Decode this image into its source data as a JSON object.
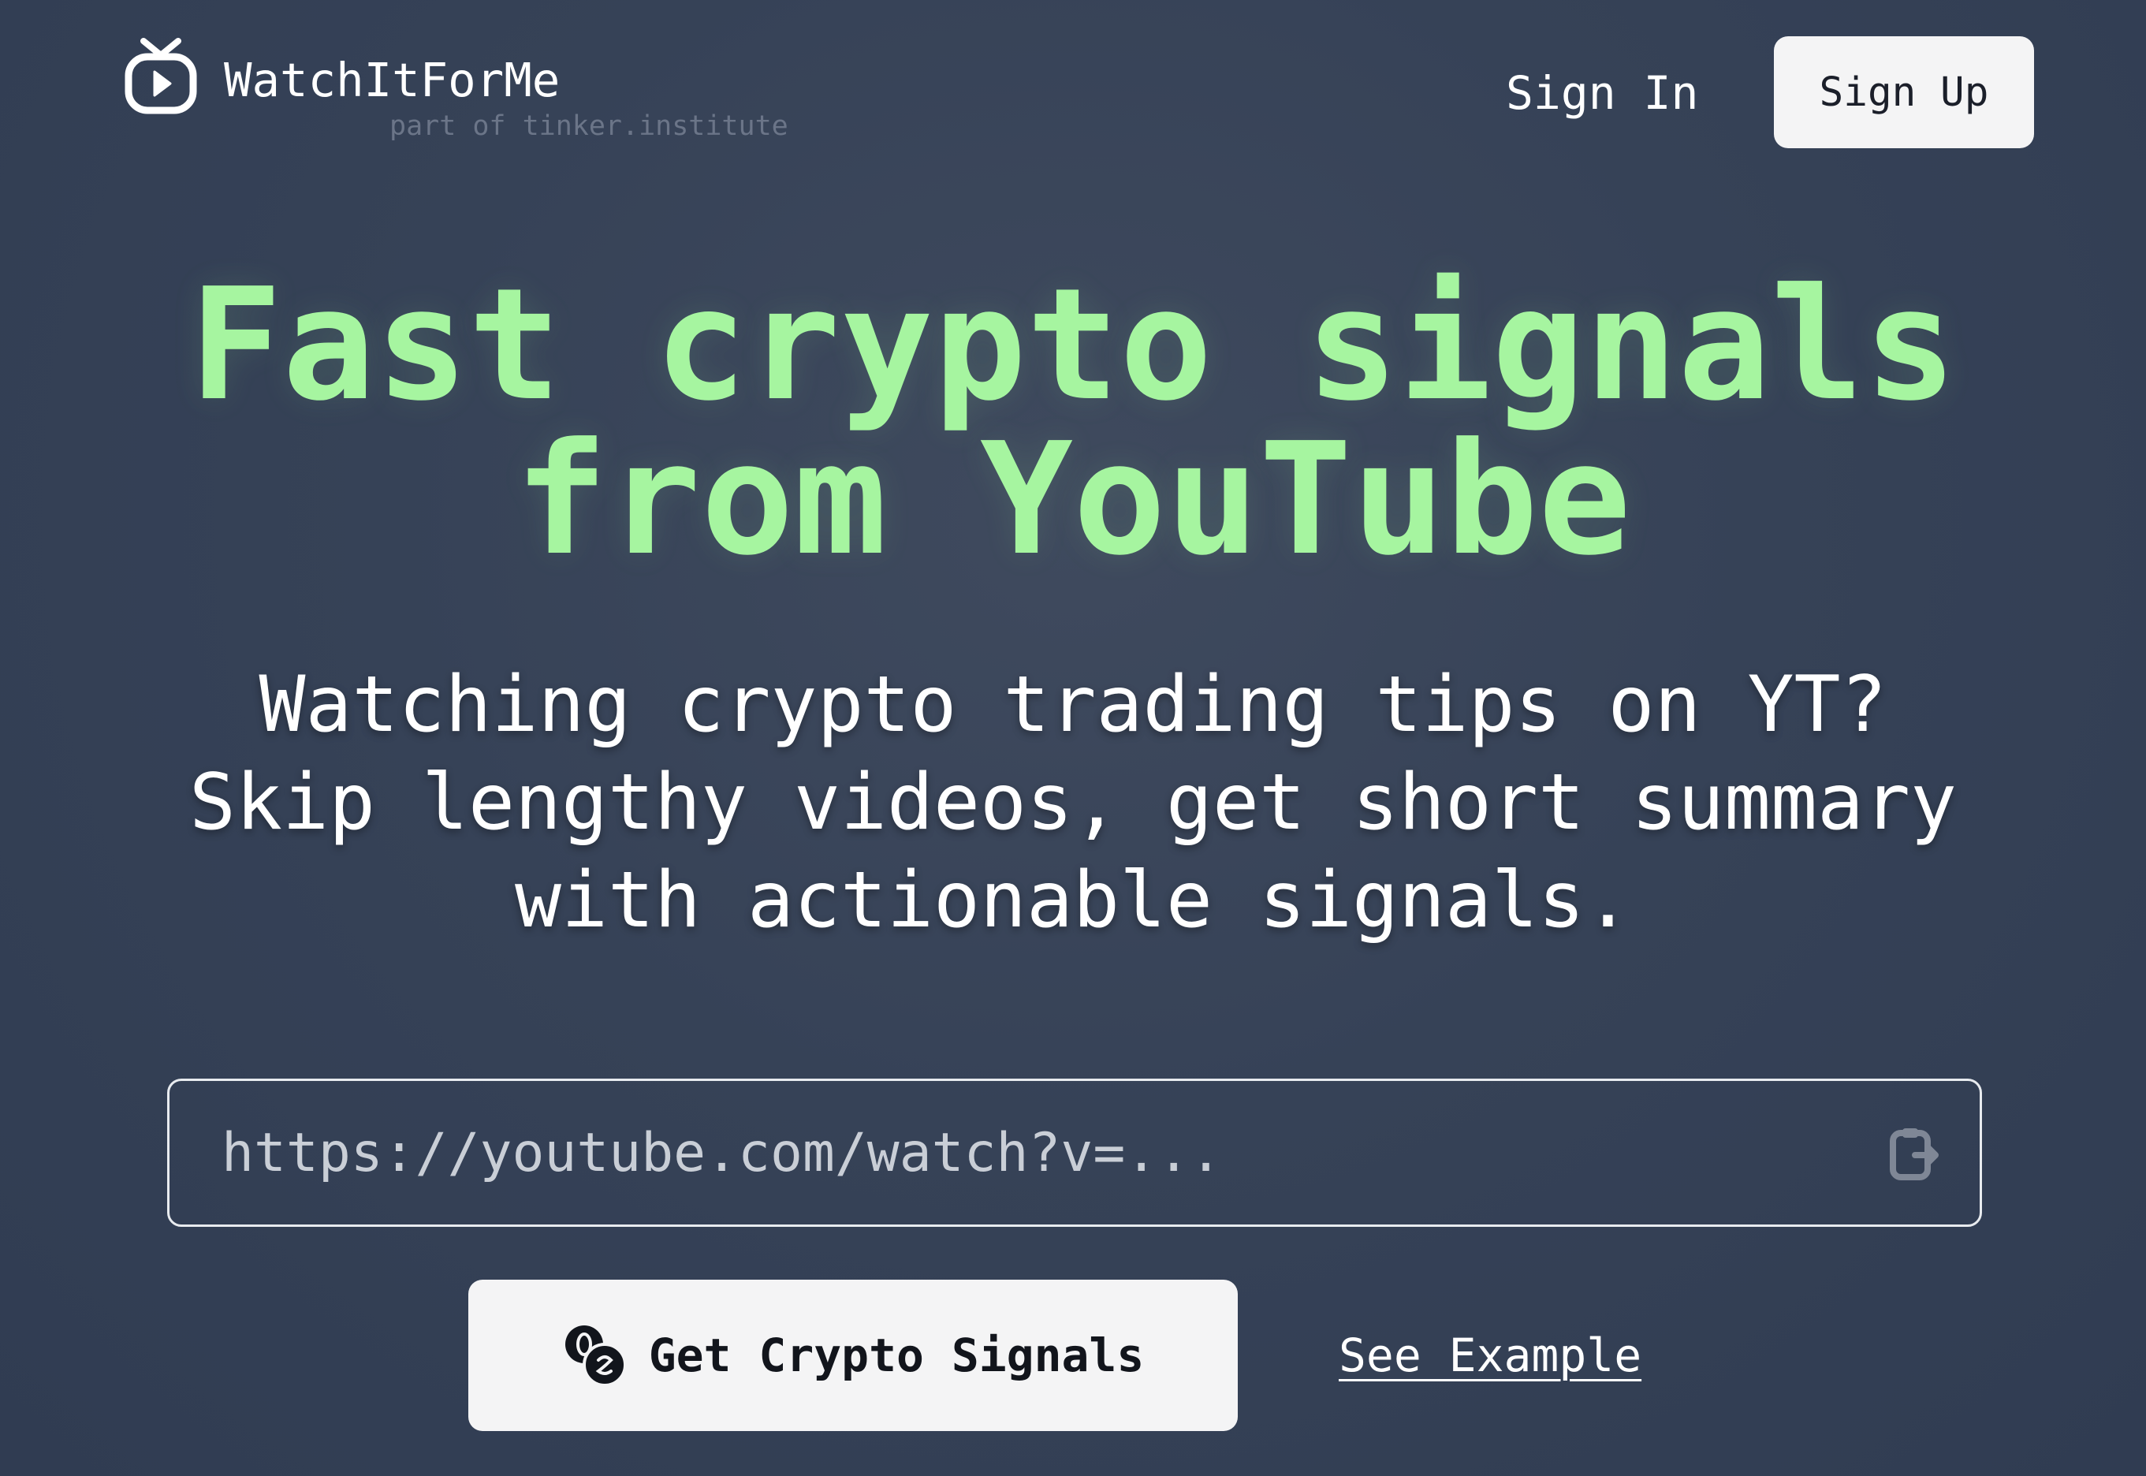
{
  "header": {
    "brand_name": "WatchItForMe",
    "brand_sub": "part of tinker.institute",
    "sign_in_label": "Sign In",
    "sign_up_label": "Sign Up"
  },
  "hero": {
    "headline_line1": "Fast crypto signals",
    "headline_line2": "from YouTube",
    "subtitle_line1": "Watching crypto trading tips on YT?",
    "subtitle_line2": "Skip lengthy videos, get short summary",
    "subtitle_line3": "with actionable signals."
  },
  "url_input": {
    "value": "",
    "placeholder": "https://youtube.com/watch?v=...",
    "paste_icon": "clipboard-paste-icon"
  },
  "actions": {
    "primary_label": "Get Crypto Signals",
    "primary_icon": "coins-icon",
    "secondary_label": "See Example"
  },
  "colors": {
    "background": "#364257",
    "accent": "#a6f5a0",
    "button_bg": "#f4f4f5",
    "muted_text": "#6b7588"
  }
}
